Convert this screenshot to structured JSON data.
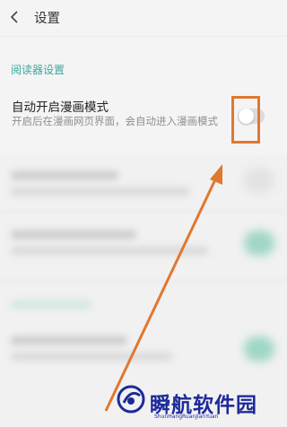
{
  "header": {
    "title": "设置",
    "back_icon": "chevron-left-icon"
  },
  "section": {
    "label": "阅读器设置"
  },
  "setting": {
    "title": "自动开启漫画模式",
    "description": "开启后在漫画网页界面，会自动进入漫画模式",
    "toggle_state": "off"
  },
  "watermark": {
    "brand": "瞬航软件园",
    "url": "ShunHangRuanJianYuan"
  },
  "colors": {
    "accent": "#3aa79e",
    "highlight": "#e0782e",
    "watermark": "#1d2a9a"
  }
}
